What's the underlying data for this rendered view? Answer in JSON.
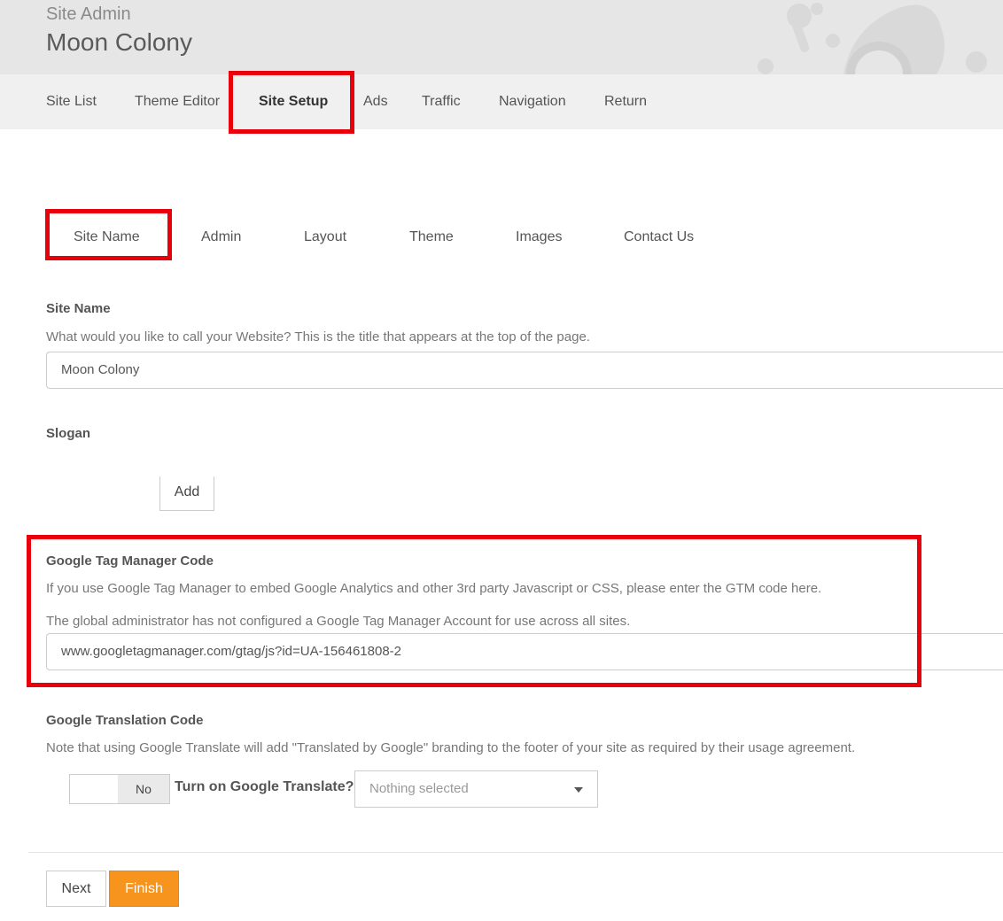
{
  "header": {
    "admin_label": "Site Admin",
    "site_title": "Moon Colony"
  },
  "nav": {
    "items": [
      {
        "label": "Site List"
      },
      {
        "label": "Theme Editor"
      },
      {
        "label": "Site Setup",
        "active": true
      },
      {
        "label": "Ads"
      },
      {
        "label": "Traffic"
      },
      {
        "label": "Navigation"
      },
      {
        "label": "Return"
      }
    ]
  },
  "tabs": [
    {
      "label": "Site Name",
      "active": true
    },
    {
      "label": "Admin"
    },
    {
      "label": "Layout"
    },
    {
      "label": "Theme"
    },
    {
      "label": "Images"
    },
    {
      "label": "Contact Us"
    }
  ],
  "site_name": {
    "label": "Site Name",
    "help": "What would you like to call your Website? This is the title that appears at the top of the page.",
    "value": "Moon Colony"
  },
  "slogan": {
    "label": "Slogan",
    "add_label": "Add"
  },
  "gtm": {
    "label": "Google Tag Manager Code",
    "help": "If you use Google Tag Manager to embed Google Analytics and other 3rd party Javascript or CSS, please enter the GTM code here.",
    "note": "The global administrator has not configured a Google Tag Manager Account for use across all sites.",
    "value": "www.googletagmanager.com/gtag/js?id=UA-156461808-2"
  },
  "translate": {
    "label": "Google Translation Code",
    "help": "Note that using Google Translate will add \"Translated by Google\" branding to the footer of your site as required by their usage agreement.",
    "toggle_label": "No",
    "question": "Turn on Google Translate?",
    "select_value": "Nothing selected"
  },
  "footer": {
    "next_label": "Next",
    "finish_label": "Finish"
  },
  "colors": {
    "highlight": "#e8000b",
    "accent": "#f7941d",
    "header_bg": "#e6e6e6",
    "nav_bg": "#f0f0f0"
  }
}
